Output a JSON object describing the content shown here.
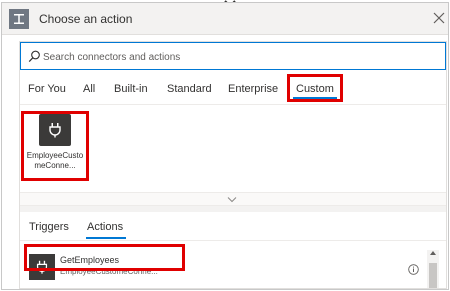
{
  "dialog": {
    "title": "Choose an action",
    "header_icon": "action-icon",
    "close_icon": "close-icon"
  },
  "search": {
    "placeholder": "Search connectors and actions",
    "value": "",
    "icon": "search-icon"
  },
  "tabs": [
    {
      "label": "For You"
    },
    {
      "label": "All"
    },
    {
      "label": "Built-in"
    },
    {
      "label": "Standard"
    },
    {
      "label": "Enterprise"
    },
    {
      "label": "Custom",
      "selected": true
    }
  ],
  "connectors": [
    {
      "label": "EmployeeCustomeConne...",
      "icon": "plug-icon"
    }
  ],
  "expand_icon": "chevron-down-icon",
  "sub_tabs": [
    {
      "label": "Triggers"
    },
    {
      "label": "Actions",
      "selected": true
    }
  ],
  "actions": [
    {
      "name": "GetEmployees",
      "subtitle": "EmployeeCustomeConne...",
      "icon": "plug-icon",
      "info_icon": "info-icon"
    }
  ],
  "colors": {
    "accent": "#0078d4",
    "highlight": "#e00000",
    "icon_bg": "#3b3a39",
    "header_bg": "#f3f2f1"
  }
}
